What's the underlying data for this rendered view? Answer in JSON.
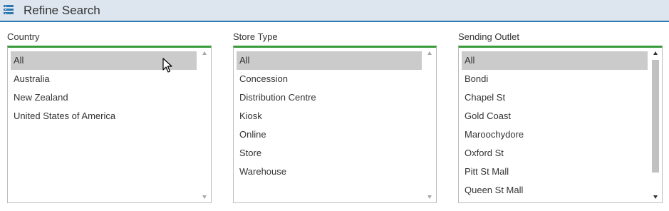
{
  "header": {
    "title": "Refine Search",
    "icon": "list-icon"
  },
  "country": {
    "label": "Country",
    "items": [
      "All",
      "Australia",
      "New Zealand",
      "United States of America"
    ],
    "selected": "All"
  },
  "store_type": {
    "label": "Store Type",
    "items": [
      "All",
      "Concession",
      "Distribution Centre",
      "Kiosk",
      "Online",
      "Store",
      "Warehouse"
    ],
    "selected": "All"
  },
  "sending_outlet": {
    "label": "Sending Outlet",
    "items": [
      "All",
      "Bondi",
      "Chapel St",
      "Gold Coast",
      "Maroochydore",
      "Oxford St",
      "Pitt St Mall",
      "Queen St Mall"
    ],
    "selected": "All"
  },
  "colors": {
    "accent": "#3a9a3a",
    "header_bg": "#dde5ee",
    "header_border": "#2e78b0",
    "selected_bg": "#cbcbcb"
  }
}
